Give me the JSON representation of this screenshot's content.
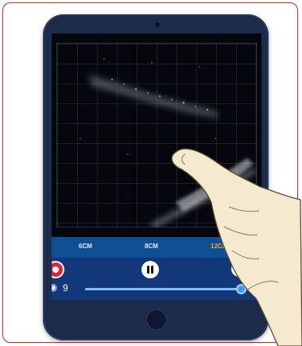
{
  "depth_options": [
    "6CM",
    "8CM",
    "12CM"
  ],
  "selected_depth": "12CM",
  "gain": {
    "value": "9",
    "level": 0.98
  },
  "colors": {
    "frame_border": "#d9252b",
    "tablet_body": "#1d2b4a",
    "depth_bar": "#0f4f94",
    "control_bar": "#12377a",
    "record_button": "#e02434",
    "selected_depth": "#f5a623",
    "slider_knob": "#3a9bff"
  },
  "icons": {
    "record": "record-icon",
    "pause": "pause-icon",
    "settings": "gear-icon",
    "gain": "gain-icon"
  }
}
